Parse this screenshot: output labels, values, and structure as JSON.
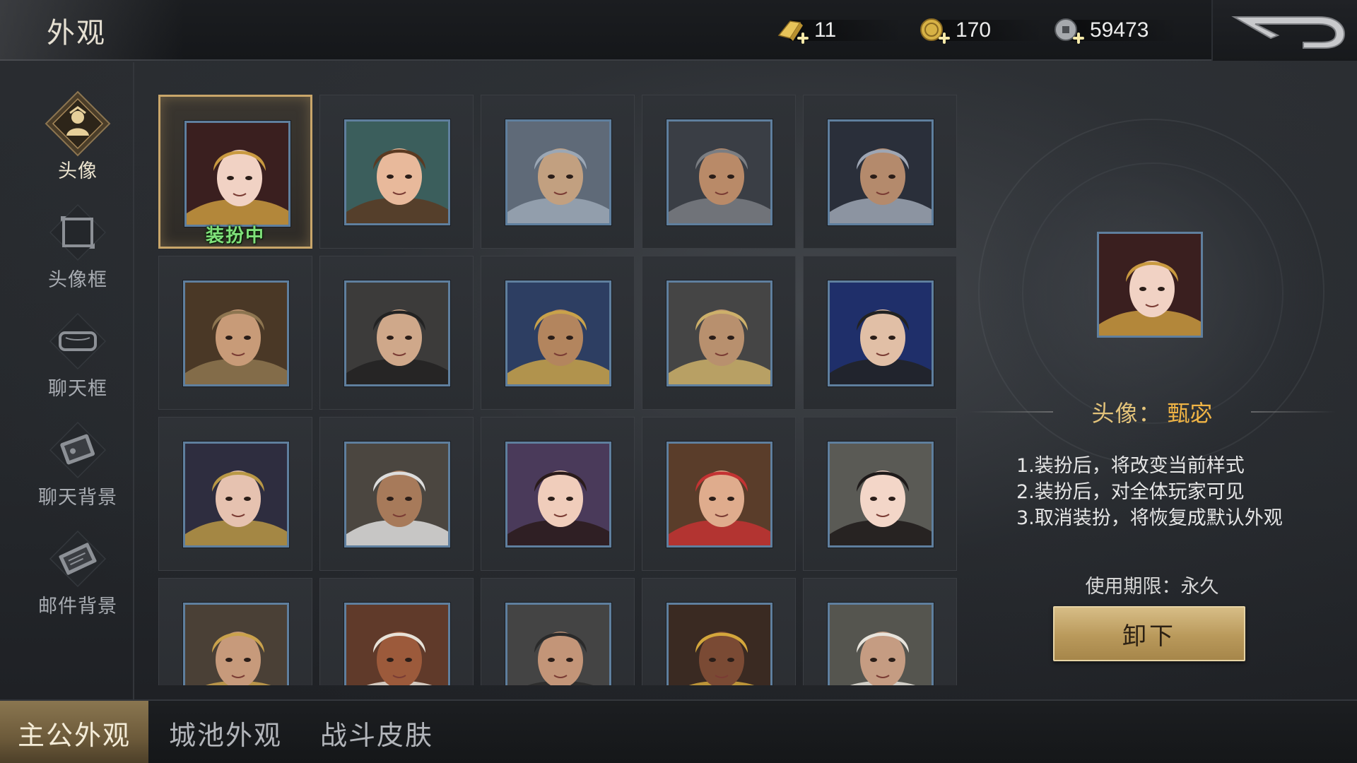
{
  "header": {
    "title": "外观",
    "currencies": [
      {
        "icon": "gold-ingot-icon",
        "value": "11"
      },
      {
        "icon": "gold-coin-icon",
        "value": "170"
      },
      {
        "icon": "copper-coin-icon",
        "value": "59473"
      }
    ],
    "back_icon": "back-arrow-icon"
  },
  "sidebar": {
    "items": [
      {
        "label": "头像",
        "icon": "avatar-icon",
        "active": true
      },
      {
        "label": "头像框",
        "icon": "avatar-frame-icon",
        "active": false
      },
      {
        "label": "聊天框",
        "icon": "chat-bubble-icon",
        "active": false
      },
      {
        "label": "聊天背景",
        "icon": "chat-background-icon",
        "active": false
      },
      {
        "label": "邮件背景",
        "icon": "mail-background-icon",
        "active": false
      }
    ]
  },
  "grid": {
    "equipped_label": "装扮中",
    "portraits": [
      {
        "icon": "portrait-icon",
        "palette": [
          "#3a1f1f",
          "#f1d2c4",
          "#c99a40"
        ]
      },
      {
        "icon": "portrait-icon",
        "palette": [
          "#3b5e5c",
          "#e8b99b",
          "#5a3a22"
        ]
      },
      {
        "icon": "portrait-icon",
        "palette": [
          "#5f6a78",
          "#c2a080",
          "#9ba7b5"
        ]
      },
      {
        "icon": "portrait-icon",
        "palette": [
          "#3a3e45",
          "#b98a68",
          "#7a7d82"
        ]
      },
      {
        "icon": "portrait-icon",
        "palette": [
          "#2a2f3a",
          "#b48a6c",
          "#9ea6b4"
        ]
      },
      {
        "icon": "portrait-icon",
        "palette": [
          "#4a3826",
          "#c89b78",
          "#8d7550"
        ]
      },
      {
        "icon": "portrait-icon",
        "palette": [
          "#3c3b3a",
          "#cfa88a",
          "#222222"
        ]
      },
      {
        "icon": "portrait-icon",
        "palette": [
          "#2d3e62",
          "#b3855e",
          "#c9a24a"
        ]
      },
      {
        "icon": "portrait-icon",
        "palette": [
          "#454545",
          "#b8906e",
          "#cdb06a"
        ]
      },
      {
        "icon": "portrait-icon",
        "palette": [
          "#1f2f6a",
          "#e1bfa6",
          "#222222"
        ]
      },
      {
        "icon": "portrait-icon",
        "palette": [
          "#2e2d3f",
          "#e6c2b0",
          "#b99845"
        ]
      },
      {
        "icon": "portrait-icon",
        "palette": [
          "#4b4640",
          "#a77a5a",
          "#dddddd"
        ]
      },
      {
        "icon": "portrait-icon",
        "palette": [
          "#4a3a5a",
          "#f0cdbb",
          "#2a1b1b"
        ]
      },
      {
        "icon": "portrait-icon",
        "palette": [
          "#5a3d2a",
          "#dfac8d",
          "#c33333"
        ]
      },
      {
        "icon": "portrait-icon",
        "palette": [
          "#5a5a55",
          "#f3d6c8",
          "#1e1a1a"
        ]
      },
      {
        "icon": "portrait-icon",
        "palette": [
          "#4a4036",
          "#c79a7b",
          "#caa24c"
        ]
      },
      {
        "icon": "portrait-icon",
        "palette": [
          "#603a2a",
          "#9c5a3b",
          "#e7e2d8"
        ]
      },
      {
        "icon": "portrait-icon",
        "palette": [
          "#444444",
          "#c39578",
          "#2a2a2a"
        ]
      },
      {
        "icon": "portrait-icon",
        "palette": [
          "#3a2a22",
          "#7a4a34",
          "#d4a73c"
        ]
      },
      {
        "icon": "portrait-icon",
        "palette": [
          "#55554f",
          "#c59c82",
          "#e8e4dc"
        ]
      }
    ]
  },
  "detail": {
    "name_label": "头像：",
    "name_value": "甄宓",
    "desc_lines": [
      "1.装扮后，将改变当前样式",
      "2.装扮后，对全体玩家可见",
      "3.取消装扮，将恢复成默认外观"
    ],
    "expiry": "使用期限：永久",
    "button": "卸下"
  },
  "tabs": [
    {
      "label": "主公外观",
      "active": true
    },
    {
      "label": "城池外观",
      "active": false
    },
    {
      "label": "战斗皮肤",
      "active": false
    }
  ]
}
